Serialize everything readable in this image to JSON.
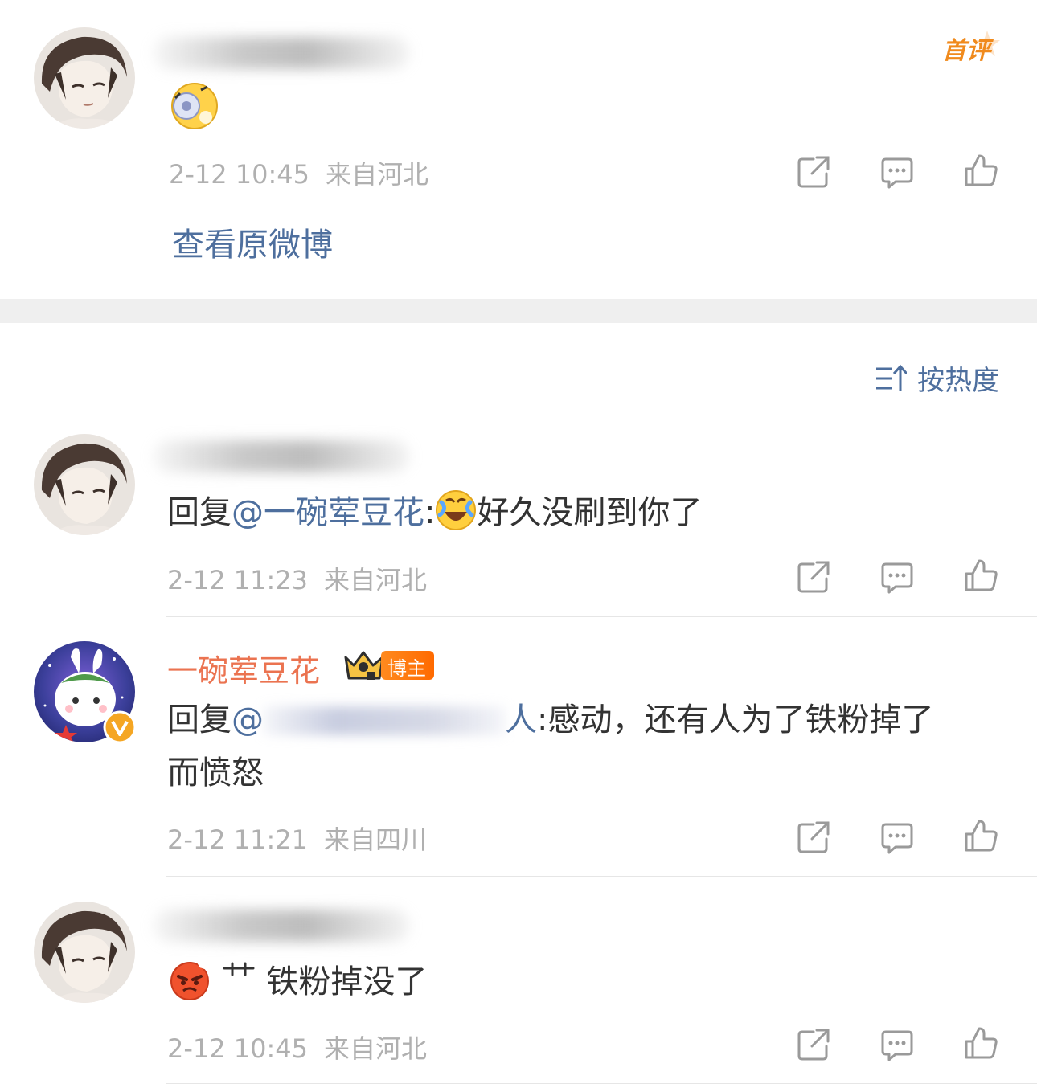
{
  "top_comment": {
    "first_badge": "首评",
    "time": "2-12 10:45",
    "location": "来自河北",
    "view_original": "查看原微博"
  },
  "sort": {
    "label": "按热度"
  },
  "comments": [
    {
      "reply_prefix": "回复",
      "mention": "@一碗荤豆花",
      "colon": ":",
      "text": "好久没刷到你了",
      "time": "2-12 11:23",
      "location": "来自河北"
    },
    {
      "name": "一碗荤豆花",
      "badge": "博主",
      "reply_prefix": "回复",
      "mention_at": "@",
      "mention_tail": "人",
      "text_line1": ":感动，还有人为了铁粉掉了",
      "text_line2": "而愤怒",
      "time": "2-12 11:21",
      "location": "来自四川"
    },
    {
      "text": "铁粉掉没了",
      "time": "2-12 10:45",
      "location": "来自河北"
    }
  ],
  "colors": {
    "link": "#4e6f9e",
    "accent_orange": "#eb7350",
    "meta_gray": "#b0b0b0",
    "separator": "#efefef"
  },
  "icons": [
    "share-icon",
    "comment-icon",
    "like-icon",
    "sort-icon",
    "crown-icon",
    "verified-icon"
  ]
}
